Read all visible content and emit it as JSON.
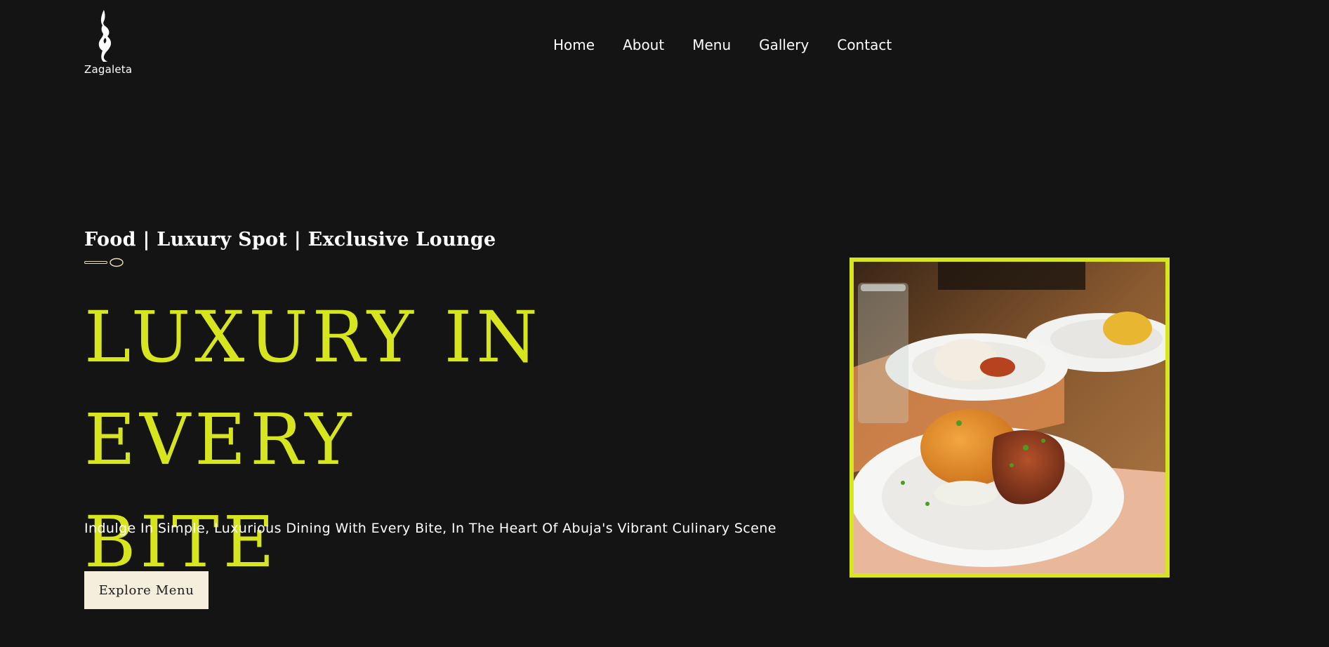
{
  "brand": {
    "name": "Zagaleta",
    "logo_icon": "gazelle-logo-icon"
  },
  "nav": {
    "items": [
      {
        "label": "Home"
      },
      {
        "label": "About"
      },
      {
        "label": "Menu"
      },
      {
        "label": "Gallery"
      },
      {
        "label": "Contact"
      }
    ]
  },
  "hero": {
    "tagline": "Food | Luxury Spot | Exclusive Lounge",
    "divider_icon": "spoon-icon",
    "headline_line1": "LUXURY IN EVERY",
    "headline_line2": "BITE",
    "subtext": "Indulge In Simple, Luxurious Dining With Every Bite, In The Heart Of Abuja's Vibrant Culinary Scene",
    "cta_label": "Explore Menu",
    "image_subject": "plate-of-jollof-rice-and-meat"
  },
  "colors": {
    "background": "#141414",
    "accent": "#d7e51e",
    "button_bg": "#f6eedd",
    "text": "#ffffff"
  }
}
